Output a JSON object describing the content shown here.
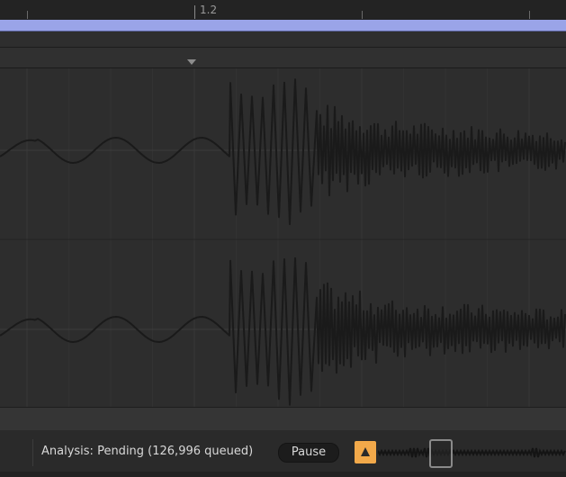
{
  "ruler": {
    "bar_label": "1.2"
  },
  "status": {
    "analysis_text": "Analysis: Pending (126,996 queued)",
    "pause_label": "Pause"
  },
  "icons": {
    "marker": "triangle-down-icon",
    "warning": "warning-triangle-icon"
  },
  "colors": {
    "background": "#2c2c2c",
    "loop_bar": "#9aa4e8",
    "waveform": "#1a1a1a",
    "warning": "#f2a94a"
  }
}
